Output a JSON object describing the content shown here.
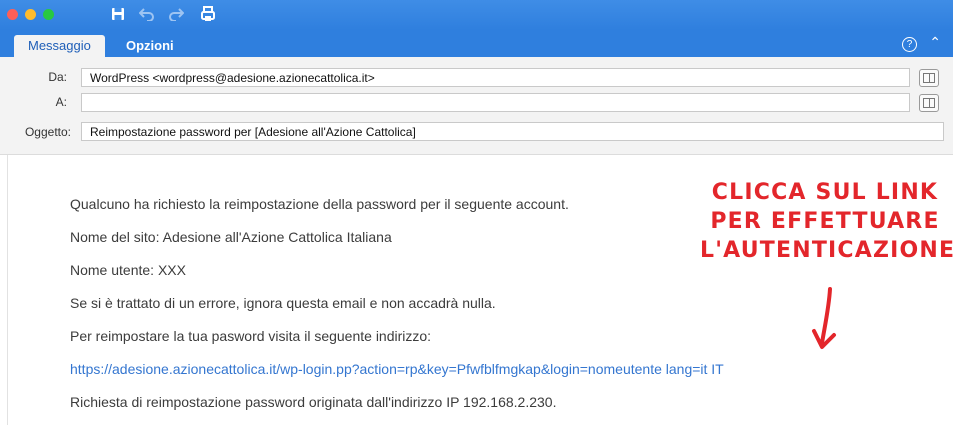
{
  "toolbar": {
    "icons": [
      "save-icon",
      "undo-icon",
      "redo-icon",
      "send-icon"
    ]
  },
  "tabs": {
    "active": "Messaggio",
    "other": "Opzioni"
  },
  "header": {
    "from_label": "Da:",
    "from_value": "WordPress <wordpress@adesione.azionecattolica.it>",
    "to_label": "A:",
    "to_value": "",
    "subject_label": "Oggetto:",
    "subject_value": "Reimpostazione password per [Adesione all'Azione Cattolica]"
  },
  "body": {
    "line1": "Qualcuno ha richiesto la reimpostazione della password per il seguente account.",
    "line2": "Nome del sito: Adesione all'Azione Cattolica Italiana",
    "line3": "Nome utente: XXX",
    "line4": "Se si è trattato di un errore, ignora questa email e non accadrà nulla.",
    "line5": "Per reimpostare la tua pasword visita il seguente indirizzo:",
    "link": "https://adesione.azionecattolica.it/wp-login.pp?action=rp&key=Pfwfblfmgkap&login=nomeutente lang=it IT",
    "line7": "Richiesta di reimpostazione password originata dall'indirizzo IP 192.168.2.230."
  },
  "annotation": {
    "line1": "CLICCA SUL LINK",
    "line2": "PER EFFETTUARE",
    "line3": "L'AUTENTICAZIONE",
    "color": "#e3262b"
  },
  "colors": {
    "accent": "#2f7fde",
    "link": "#3476d0"
  }
}
